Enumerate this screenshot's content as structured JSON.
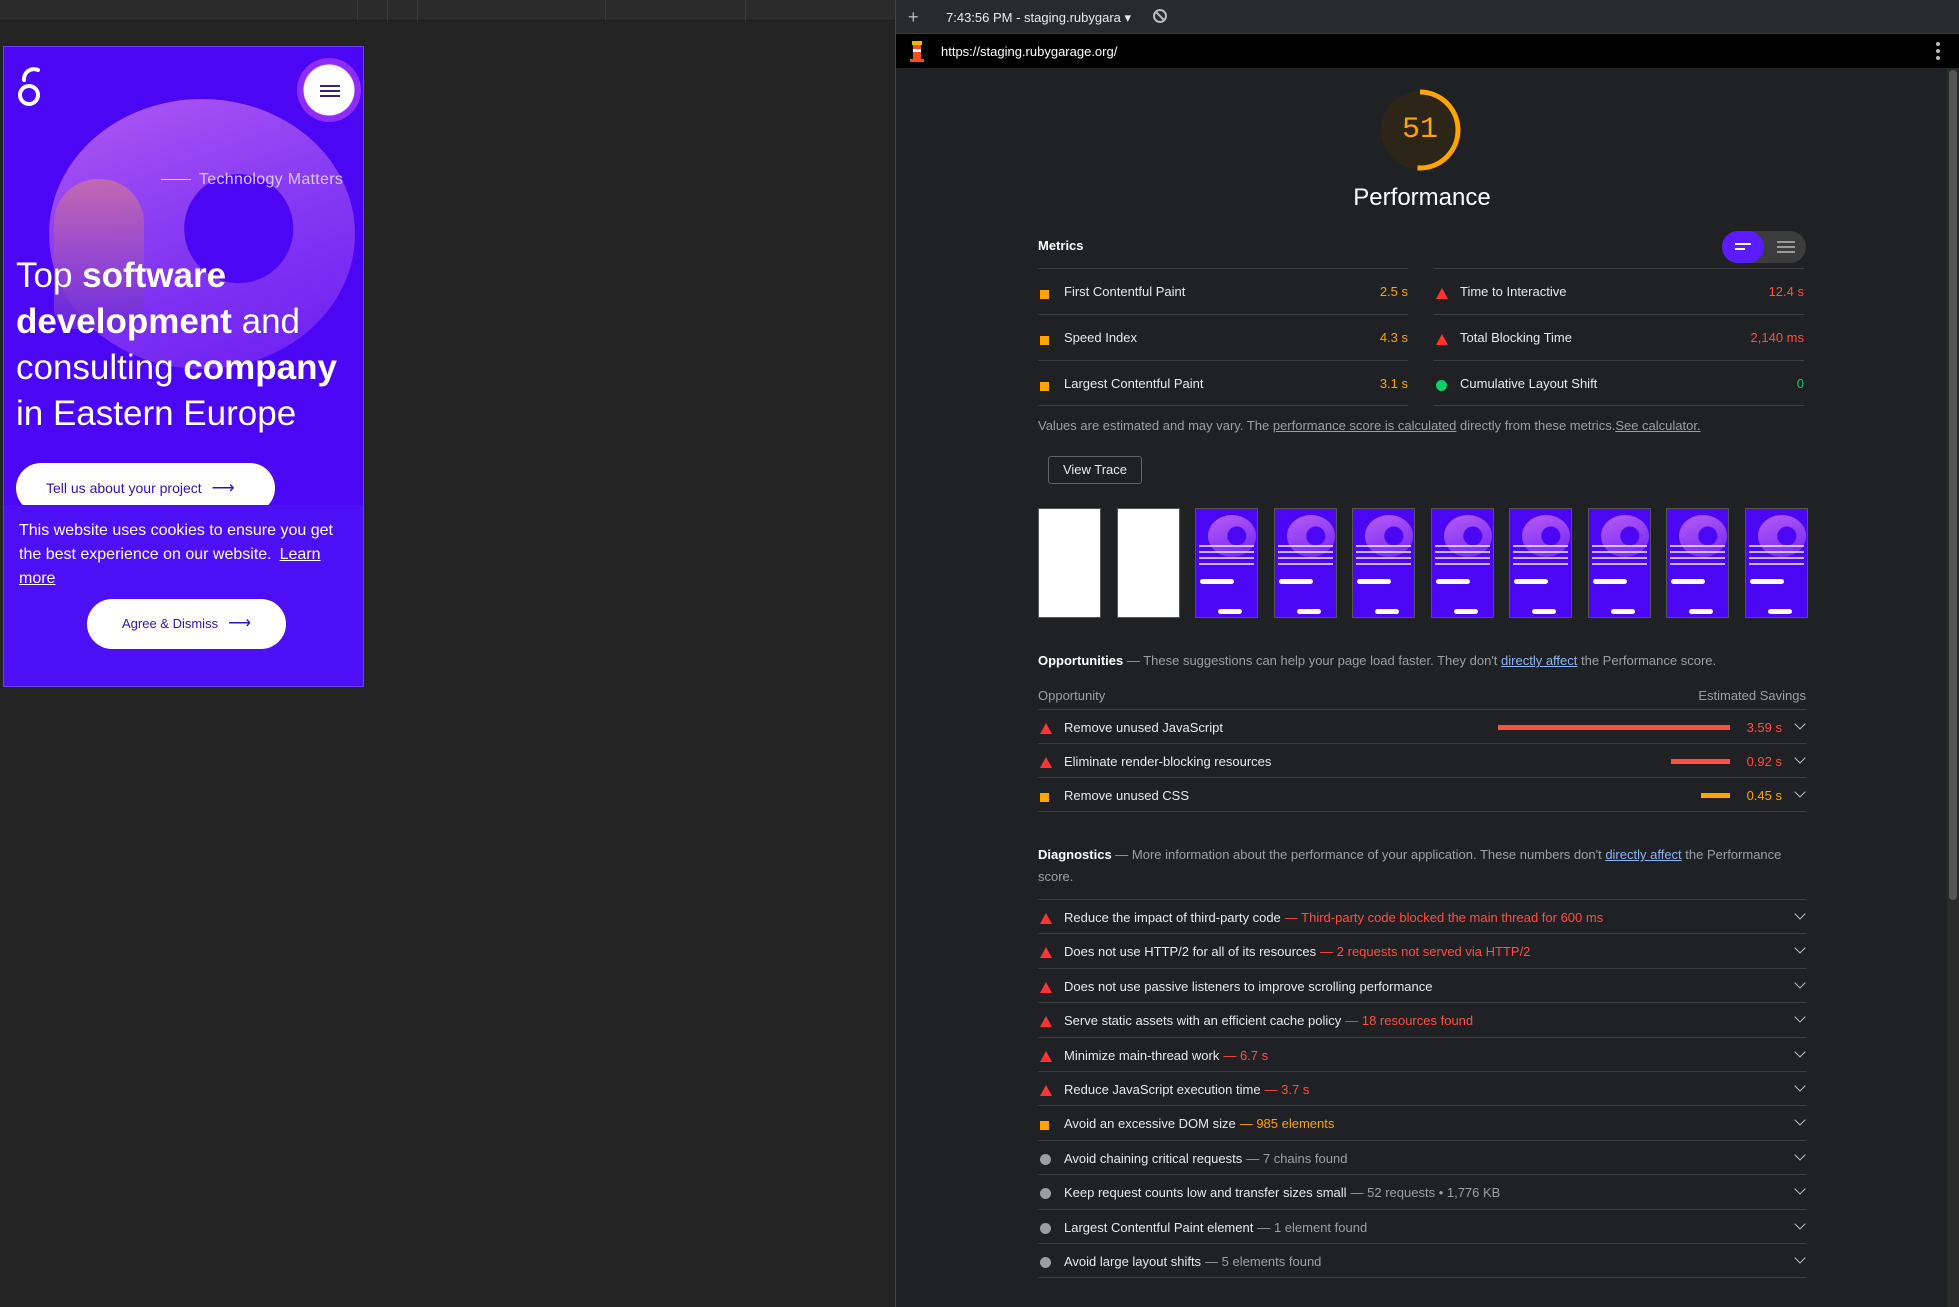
{
  "phone": {
    "tagline": "Technology Matters",
    "headline": {
      "p1": "Top ",
      "p2": "software",
      "p3": "development",
      "p4": " and consulting ",
      "p5": "company",
      "p6": " in Eastern Europe"
    },
    "cta_label": "Tell us about your project",
    "cookie_text": "This website uses cookies to ensure you get the best experience on our website.",
    "cookie_link": "Learn more",
    "agree_label": "Agree & Dismiss"
  },
  "devtools": {
    "time_label": "7:43:56 PM - staging.rubygara ▾",
    "url": "https://staging.rubygarage.org/"
  },
  "report": {
    "score": "51",
    "score_fraction": 0.51,
    "category_title": "Performance",
    "metrics_label": "Metrics",
    "metrics_left": [
      {
        "name": "First Contentful Paint",
        "value": "2.5 s",
        "status": "average"
      },
      {
        "name": "Speed Index",
        "value": "4.3 s",
        "status": "average"
      },
      {
        "name": "Largest Contentful Paint",
        "value": "3.1 s",
        "status": "average"
      }
    ],
    "metrics_right": [
      {
        "name": "Time to Interactive",
        "value": "12.4 s",
        "status": "fail"
      },
      {
        "name": "Total Blocking Time",
        "value": "2,140 ms",
        "status": "fail"
      },
      {
        "name": "Cumulative Layout Shift",
        "value": "0",
        "status": "pass"
      }
    ],
    "note": {
      "t1": "Values are estimated and may vary. The ",
      "link1": "performance score is calculated",
      "t2": " directly from these metrics.",
      "link2": "See calculator."
    },
    "view_trace": "View Trace",
    "opportunities": {
      "title": "Opportunities",
      "desc1": " — These suggestions can help your page load faster. They don't ",
      "link": "directly affect",
      "desc2": " the Performance score.",
      "col_left": "Opportunity",
      "col_right": "Estimated Savings",
      "items": [
        {
          "name": "Remove unused JavaScript",
          "savings": "3.59 s",
          "status": "fail",
          "fraction": 1.0
        },
        {
          "name": "Eliminate render-blocking resources",
          "savings": "0.92 s",
          "status": "fail",
          "fraction": 0.256
        },
        {
          "name": "Remove unused CSS",
          "savings": "0.45 s",
          "status": "average",
          "fraction": 0.125
        }
      ]
    },
    "diagnostics": {
      "title": "Diagnostics",
      "desc1": " — More information about the performance of your application. These numbers don't ",
      "link": "directly affect",
      "desc2": " the Performance score.",
      "items": [
        {
          "name": "Reduce the impact of third-party code",
          "detail": "— Third-party code blocked the main thread for 600 ms",
          "status": "fail"
        },
        {
          "name": "Does not use HTTP/2 for all of its resources",
          "detail": "— 2 requests not served via HTTP/2",
          "status": "fail"
        },
        {
          "name": "Does not use passive listeners to improve scrolling performance",
          "detail": "",
          "status": "fail"
        },
        {
          "name": "Serve static assets with an efficient cache policy",
          "detail": "— 18 resources found",
          "status": "fail"
        },
        {
          "name": "Minimize main-thread work",
          "detail": "— 6.7 s",
          "status": "fail"
        },
        {
          "name": "Reduce JavaScript execution time",
          "detail": "— 3.7 s",
          "status": "fail"
        },
        {
          "name": "Avoid an excessive DOM size",
          "detail": "— 985 elements",
          "status": "average"
        },
        {
          "name": "Avoid chaining critical requests",
          "detail": "— 7 chains found",
          "status": "info"
        },
        {
          "name": "Keep request counts low and transfer sizes small",
          "detail": "— 52 requests • 1,776 KB",
          "status": "info"
        },
        {
          "name": "Largest Contentful Paint element",
          "detail": "— 1 element found",
          "status": "info"
        },
        {
          "name": "Avoid large layout shifts",
          "detail": "— 5 elements found",
          "status": "info"
        }
      ]
    },
    "colors": {
      "fail": "#ff4e42",
      "average": "#ffa400",
      "pass": "#0cce6b",
      "info": "#9e9e9e",
      "accent": "#5c1bff"
    }
  }
}
